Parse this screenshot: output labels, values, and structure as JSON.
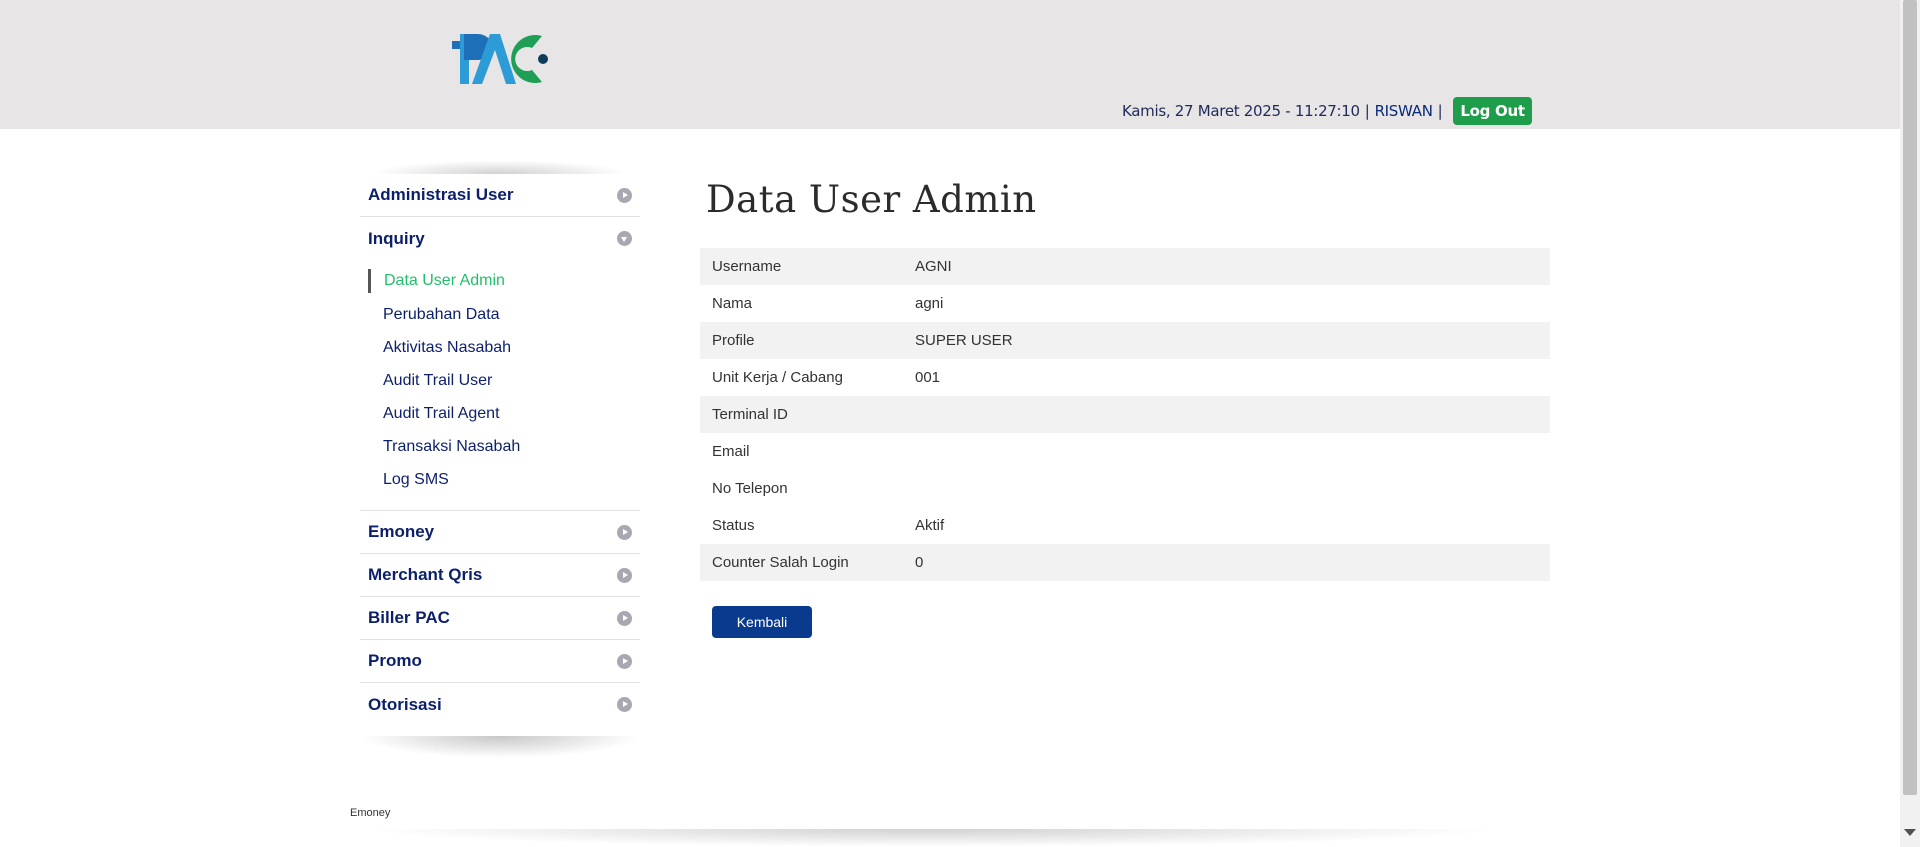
{
  "header": {
    "logo_alt": "PAC",
    "datetime": "Kamis, 27 Maret 2025 - 11:27:10",
    "separator": "|",
    "username": "RISWAN",
    "logout_label": "Log Out"
  },
  "sidebar": {
    "menus": [
      {
        "label": "Administrasi User",
        "expanded": false
      },
      {
        "label": "Inquiry",
        "expanded": true,
        "items": [
          "Data User Admin",
          "Perubahan Data",
          "Aktivitas Nasabah",
          "Audit Trail User",
          "Audit Trail Agent",
          "Transaksi Nasabah",
          "Log SMS"
        ]
      },
      {
        "label": "Emoney",
        "expanded": false
      },
      {
        "label": "Merchant Qris",
        "expanded": false
      },
      {
        "label": "Biller PAC",
        "expanded": false
      },
      {
        "label": "Promo",
        "expanded": false
      },
      {
        "label": "Otorisasi",
        "expanded": false
      }
    ],
    "active_item": "Data User Admin"
  },
  "main": {
    "title": "Data User Admin",
    "rows": [
      {
        "label": "Username",
        "value": "AGNI"
      },
      {
        "label": "Nama",
        "value": "agni"
      },
      {
        "label": "Profile",
        "value": "SUPER USER"
      },
      {
        "label": "Unit Kerja / Cabang",
        "value": "001"
      },
      {
        "label": "Terminal ID",
        "value": ""
      },
      {
        "label": "Email",
        "value": ""
      },
      {
        "label": "No Telepon",
        "value": ""
      },
      {
        "label": "Status",
        "value": "Aktif"
      },
      {
        "label": "Counter Salah Login",
        "value": "0"
      }
    ],
    "back_label": "Kembali"
  },
  "footer": {
    "text": "Emoney"
  },
  "colors": {
    "header_bg": "#e7e5e6",
    "brand_blue": "#0c1f6b",
    "active_green": "#22c06a",
    "logout_green": "#1e9e4a",
    "button_blue": "#0a3a8e"
  }
}
